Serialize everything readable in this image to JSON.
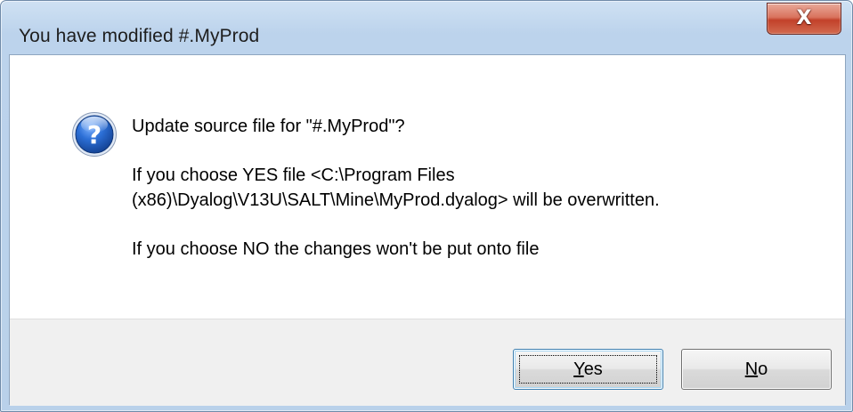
{
  "window": {
    "title": "You have modified #.MyProd",
    "close_label": "X"
  },
  "icon": "question-icon",
  "message": {
    "line1": "Update source file for \"#.MyProd\"?",
    "line2a": "If you choose YES file <C:\\Program Files",
    "line2b": "(x86)\\Dyalog\\V13U\\SALT\\Mine\\MyProd.dyalog> will be overwritten.",
    "line3": "If you choose NO the changes won't be put onto file"
  },
  "buttons": {
    "yes": {
      "mnemonic": "Y",
      "rest": "es"
    },
    "no": {
      "mnemonic": "N",
      "rest": "o"
    }
  },
  "colors": {
    "close_button": "#c2412a",
    "titlebar": "#b9d1ea",
    "icon_blue": "#1f56b0"
  }
}
